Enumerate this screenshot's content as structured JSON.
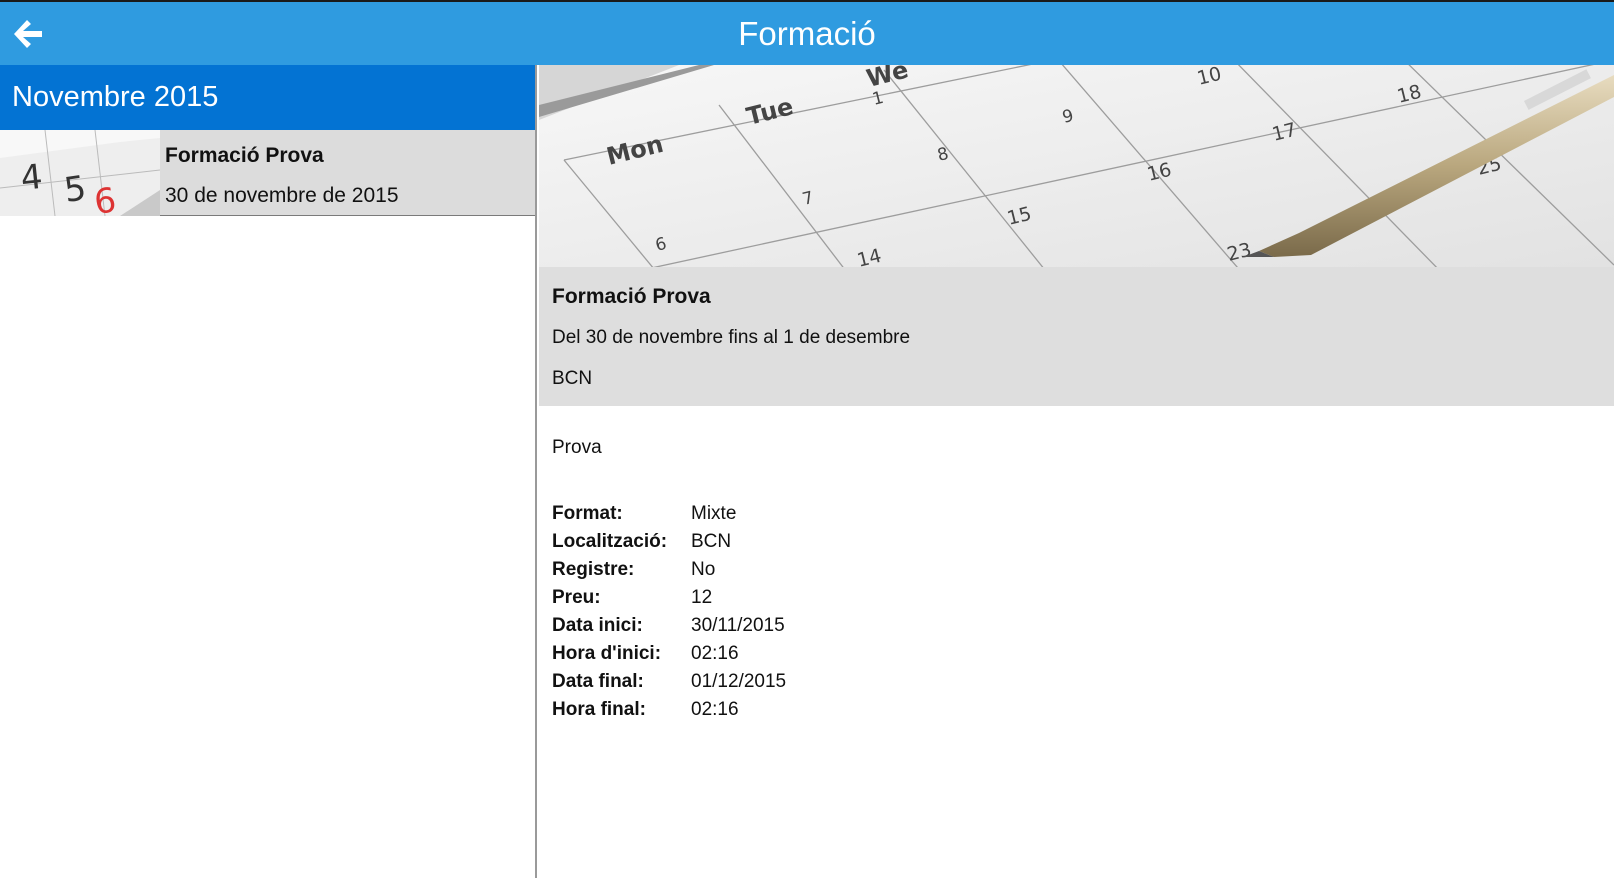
{
  "header": {
    "title": "Formació",
    "back_icon": "arrow-left-icon"
  },
  "list": {
    "month": "Novembre 2015",
    "items": [
      {
        "title": "Formació Prova",
        "date": "30 de novembre de 2015"
      }
    ]
  },
  "detail": {
    "title": "Formació Prova",
    "range": "Del 30 de novembre fins al 1 de desembre",
    "location": "BCN",
    "description": "Prova",
    "fields": [
      {
        "label": "Format:",
        "value": "Mixte"
      },
      {
        "label": "Localització:",
        "value": "BCN"
      },
      {
        "label": "Registre:",
        "value": "No"
      },
      {
        "label": "Preu:",
        "value": "12"
      },
      {
        "label": "Data inici:",
        "value": "30/11/2015"
      },
      {
        "label": "Hora d'inici:",
        "value": "02:16"
      },
      {
        "label": "Data final:",
        "value": "01/12/2015"
      },
      {
        "label": "Hora final:",
        "value": "02:16"
      }
    ]
  },
  "colors": {
    "topbar": "#2f9be0",
    "month_header": "#0373d3",
    "item_bg": "#dcdcdc",
    "summary_bg": "#dedede"
  }
}
